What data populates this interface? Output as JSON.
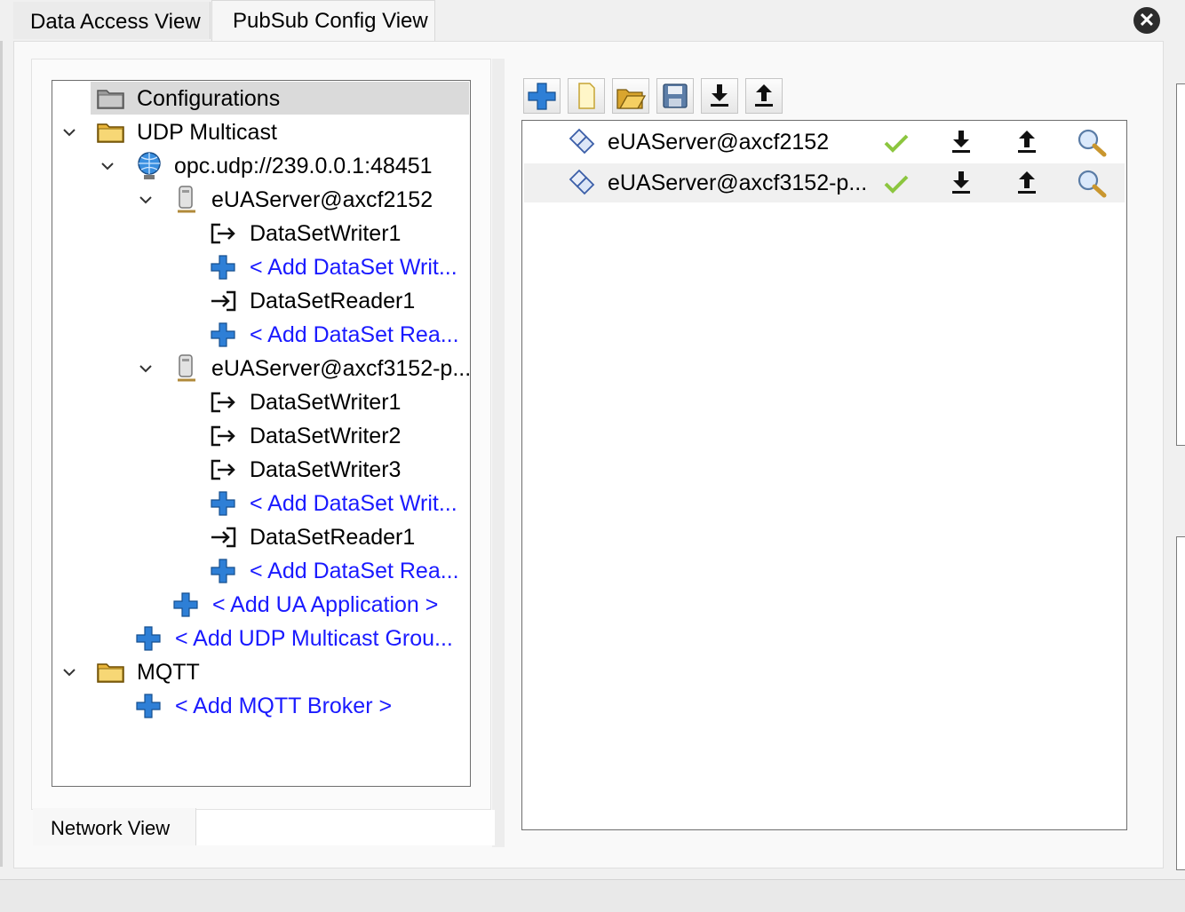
{
  "tabs": [
    {
      "label": "Data Access View"
    },
    {
      "label": "PubSub Config View"
    }
  ],
  "bottom_tab": {
    "label": "Network View"
  },
  "tree": {
    "root": "Configurations",
    "udp_group": "UDP Multicast",
    "endpoint": "opc.udp://239.0.0.1:48451",
    "app1": {
      "name": "eUAServer@axcf2152",
      "writers": [
        "DataSetWriter1"
      ],
      "add_writer": "< Add DataSet Writ...",
      "readers": [
        "DataSetReader1"
      ],
      "add_reader": "< Add DataSet Rea..."
    },
    "app2": {
      "name": "eUAServer@axcf3152-p...",
      "writers": [
        "DataSetWriter1",
        "DataSetWriter2",
        "DataSetWriter3"
      ],
      "add_writer": "< Add DataSet Writ...",
      "readers": [
        "DataSetReader1"
      ],
      "add_reader": "< Add DataSet Rea..."
    },
    "add_application": "< Add UA Application >",
    "add_udp_group": "< Add UDP Multicast Grou...",
    "mqtt_group": "MQTT",
    "add_mqtt_broker": "< Add MQTT Broker >"
  },
  "toolbar": {
    "buttons": [
      "add-icon",
      "new-file-icon",
      "open-folder-icon",
      "save-icon",
      "download-icon",
      "upload-icon"
    ]
  },
  "list": {
    "rows": [
      {
        "name": "eUAServer@axcf2152"
      },
      {
        "name": "eUAServer@axcf3152-p..."
      }
    ]
  },
  "colors": {
    "link": "#1a1aff",
    "selection": "#dadada",
    "check": "#8cc63f"
  }
}
